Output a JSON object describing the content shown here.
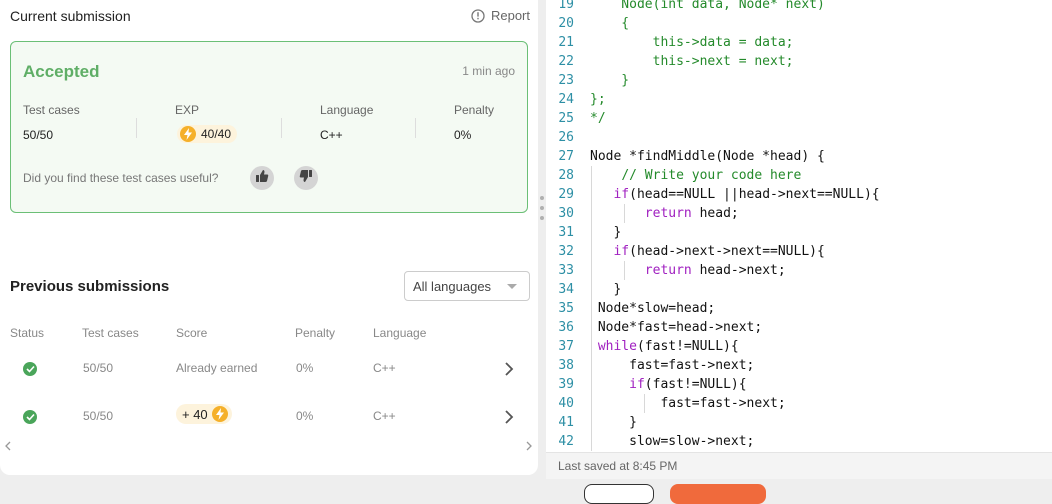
{
  "current_submission": {
    "title": "Current submission",
    "report_label": "Report",
    "status": "Accepted",
    "time_ago": "1 min ago",
    "stats": {
      "test_cases_label": "Test cases",
      "test_cases_value": "50/50",
      "exp_label": "EXP",
      "exp_value": "40/40",
      "language_label": "Language",
      "language_value": "C++",
      "penalty_label": "Penalty",
      "penalty_value": "0%"
    },
    "feedback_question": "Did you find these test cases useful?"
  },
  "previous_submissions": {
    "title": "Previous submissions",
    "filter_value": "All languages",
    "columns": [
      "Status",
      "Test cases",
      "Score",
      "Penalty",
      "Language"
    ],
    "rows": [
      {
        "test_cases": "50/50",
        "score": "Already earned",
        "penalty": "0%",
        "language": "C++"
      },
      {
        "test_cases": "50/50",
        "score": "+ 40",
        "penalty": "0%",
        "language": "C++"
      }
    ]
  },
  "editor": {
    "lines": [
      {
        "n": "19",
        "text": "    Node(int data, Node* next)"
      },
      {
        "n": "20",
        "text": "    {"
      },
      {
        "n": "21",
        "text": "        this->data = data;"
      },
      {
        "n": "22",
        "text": "        this->next = next;"
      },
      {
        "n": "23",
        "text": "    }"
      },
      {
        "n": "24",
        "text": "};"
      },
      {
        "n": "25",
        "text": "*/"
      },
      {
        "n": "26",
        "text": ""
      },
      {
        "n": "27",
        "text": "Node *findMiddle(Node *head) {"
      },
      {
        "n": "28",
        "text": "    // Write your code here"
      },
      {
        "n": "29",
        "text": "   if(head==NULL ||head->next==NULL){"
      },
      {
        "n": "30",
        "text": "       return head;"
      },
      {
        "n": "31",
        "text": "   }"
      },
      {
        "n": "32",
        "text": "   if(head->next->next==NULL){"
      },
      {
        "n": "33",
        "text": "       return head->next;"
      },
      {
        "n": "34",
        "text": "   }"
      },
      {
        "n": "35",
        "text": " Node*slow=head;"
      },
      {
        "n": "36",
        "text": " Node*fast=head->next;"
      },
      {
        "n": "37",
        "text": " while(fast!=NULL){"
      },
      {
        "n": "38",
        "text": "     fast=fast->next;"
      },
      {
        "n": "39",
        "text": "     if(fast!=NULL){"
      },
      {
        "n": "40",
        "text": "         fast=fast->next;"
      },
      {
        "n": "41",
        "text": "     }"
      },
      {
        "n": "42",
        "text": "     slow=slow->next;"
      }
    ],
    "last_saved": "Last saved at 8:45 PM"
  },
  "colors": {
    "accent_green": "#5fae66",
    "card_border": "#6bbf76",
    "exp_gold": "#f5b02a",
    "primary_orange": "#f06a3c",
    "line_number": "#2d8fa5",
    "code_comment": "#248a2b",
    "code_keyword": "#a020c0"
  },
  "icons": {
    "report": "info-circle-icon",
    "exp": "lightning-bolt-icon",
    "thumbs_up": "thumbs-up-icon",
    "thumbs_down": "thumbs-down-icon",
    "status": "check-circle-icon",
    "row_action": "chevron-right-icon",
    "filter_caret": "caret-down-icon"
  }
}
